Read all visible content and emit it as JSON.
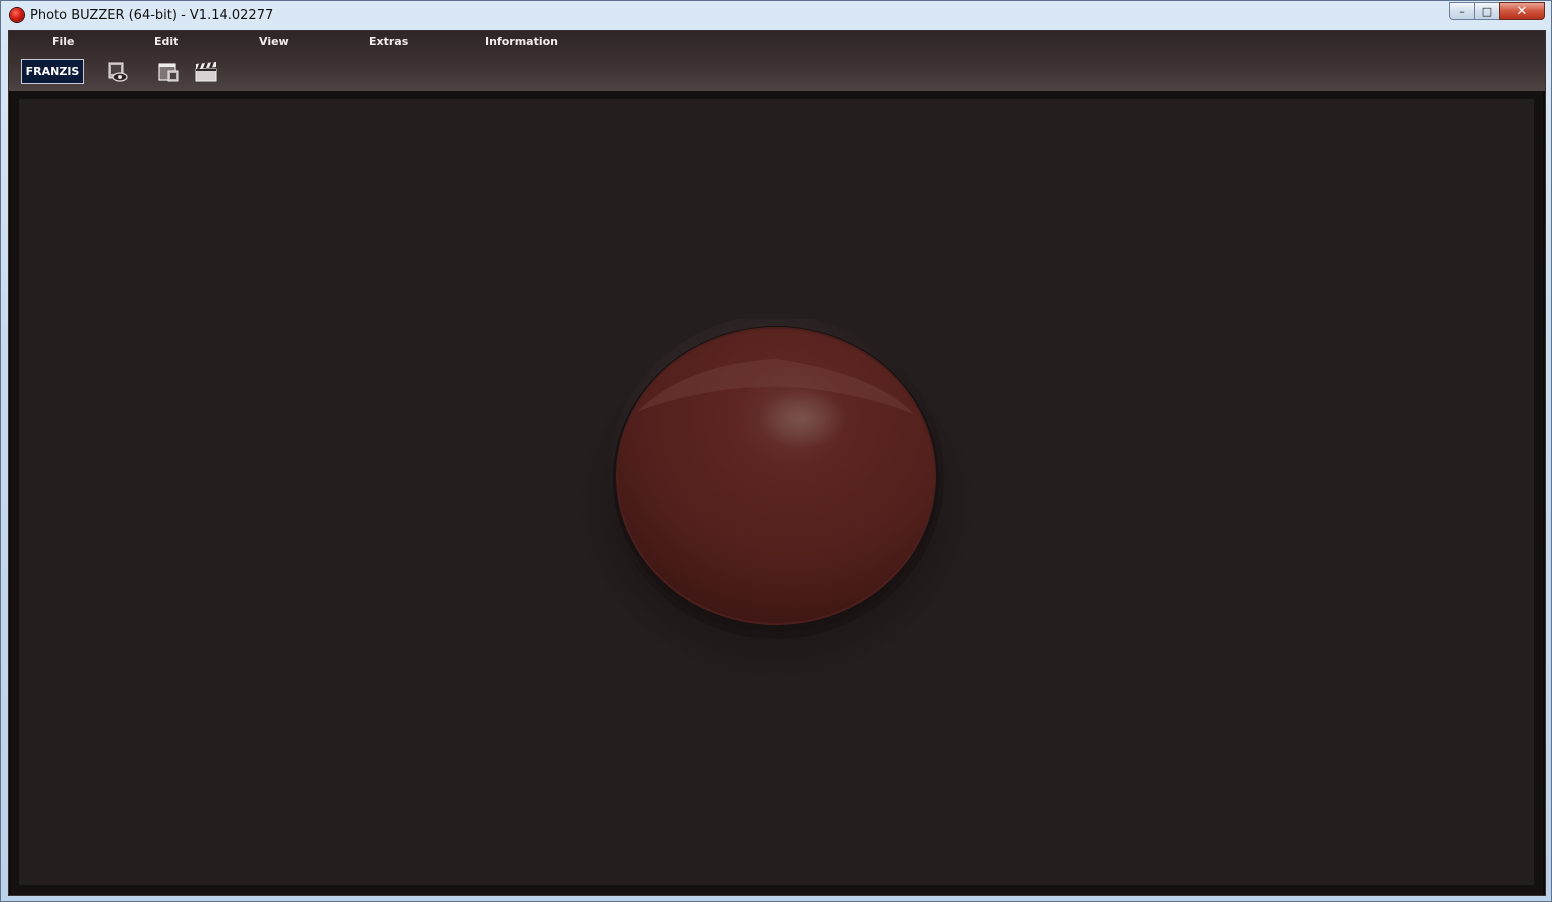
{
  "window": {
    "title": "Photo BUZZER (64-bit) - V1.14.02277",
    "controls": {
      "minimize": "–",
      "maximize": "□",
      "close": "✕"
    }
  },
  "menu": {
    "items": [
      {
        "label": "File"
      },
      {
        "label": "Edit"
      },
      {
        "label": "View"
      },
      {
        "label": "Extras"
      },
      {
        "label": "Information"
      }
    ]
  },
  "toolbar": {
    "logo": "FRANZIS",
    "icons": [
      "camera-preview-icon",
      "window-overlay-icon",
      "clapperboard-icon"
    ]
  },
  "canvas": {
    "buzzer_color": "#5a201c",
    "background_color": "#251e1e"
  }
}
